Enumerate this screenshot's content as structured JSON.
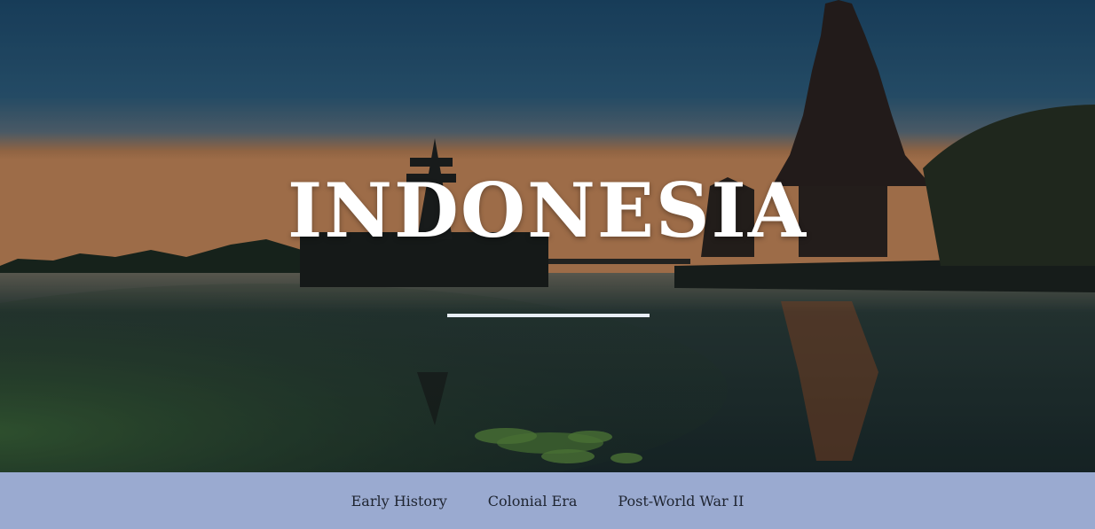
{
  "hero": {
    "title": "INDONESIA"
  },
  "nav": {
    "items": [
      {
        "label": "Early History"
      },
      {
        "label": "Colonial Era"
      },
      {
        "label": "Post-World War II"
      }
    ]
  },
  "colors": {
    "nav_background": "#9aaad0",
    "nav_text": "#1e2430",
    "title_text": "#ffffff",
    "underline": "#e8eef6"
  }
}
